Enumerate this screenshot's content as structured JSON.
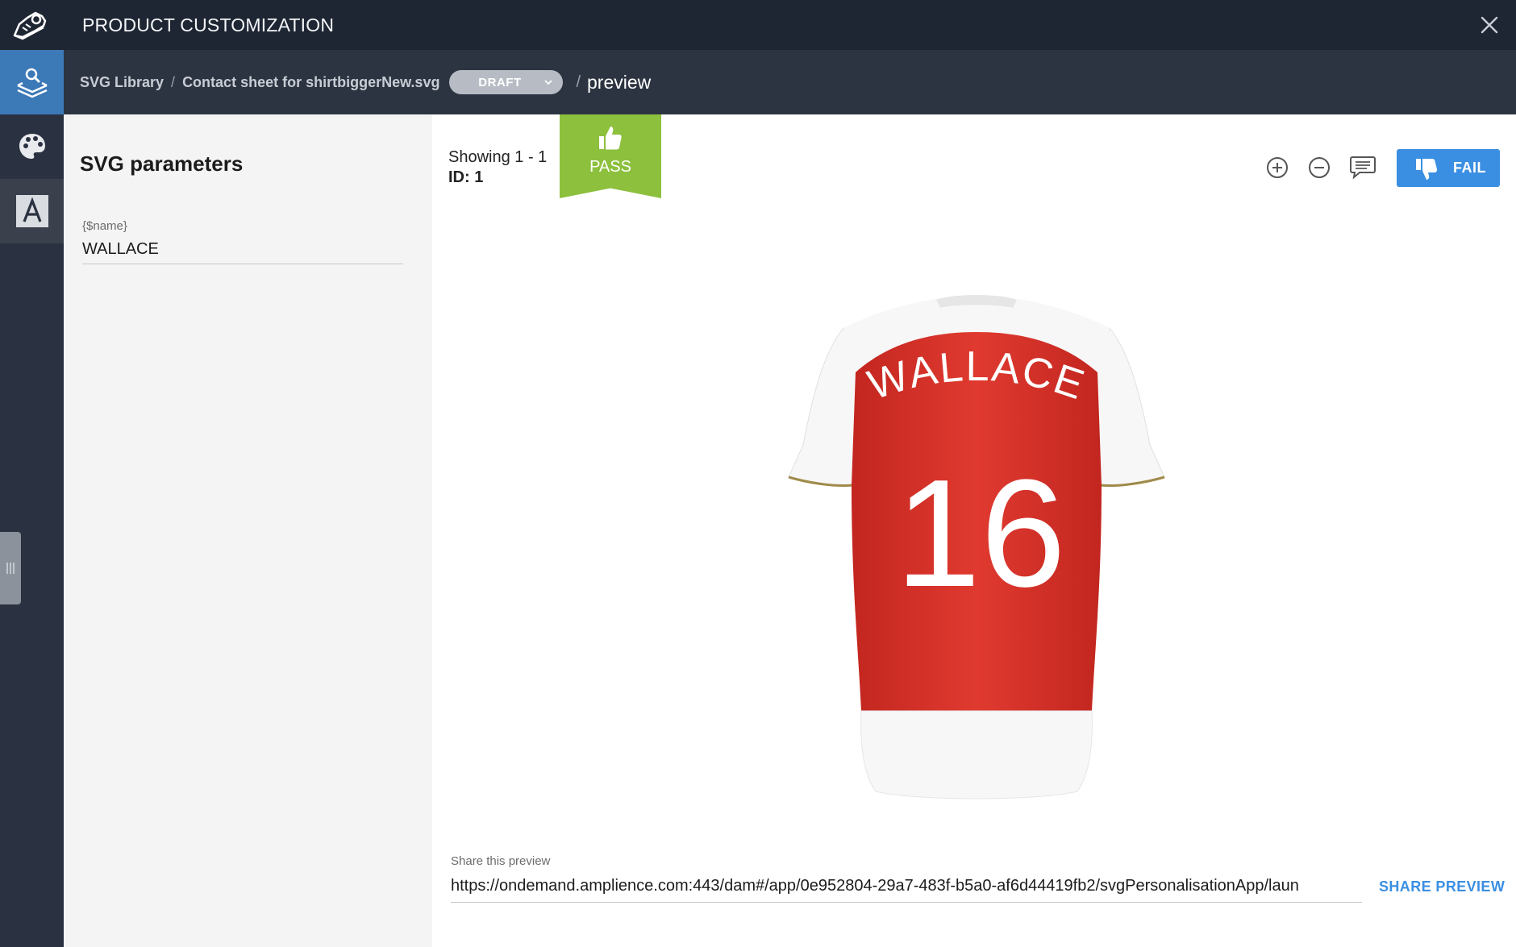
{
  "app": {
    "title": "PRODUCT CUSTOMIZATION",
    "logo_icon": "sneaker-logo-icon",
    "close_icon": "close-icon"
  },
  "breadcrumb": {
    "items": [
      "SVG Library",
      "Contact sheet for shirtbiggerNew.svg"
    ],
    "status": "DRAFT",
    "current": "preview"
  },
  "rail": {
    "items": [
      {
        "icon": "layers-search-icon",
        "active": true
      },
      {
        "icon": "palette-icon",
        "active": false
      },
      {
        "icon": "font-icon",
        "active": false
      }
    ]
  },
  "params": {
    "title": "SVG parameters",
    "fields": [
      {
        "label": "{$name}",
        "value": "WALLACE"
      }
    ]
  },
  "preview": {
    "showing": "Showing 1 - 1",
    "id_line": "ID: 1",
    "pass_label": "PASS",
    "fail_label": "FAIL",
    "tools": [
      "zoom-in-icon",
      "zoom-out-icon",
      "comment-icon"
    ],
    "shirt": {
      "name": "WALLACE",
      "number": "16",
      "body_color": "#d8342b",
      "sleeve_color": "#ffffff"
    },
    "share": {
      "label": "Share this preview",
      "url": "https://ondemand.amplience.com:443/dam#/app/0e952804-29a7-483f-b5a0-af6d44419fb2/svgPersonalisationApp/laun",
      "button_label": "SHARE PREVIEW"
    }
  },
  "colors": {
    "topbar": "#1f2633",
    "crumbbar": "#2d3441",
    "rail_active": "#3c79b7",
    "pass": "#8cc03d",
    "fail": "#3b8fe3"
  }
}
